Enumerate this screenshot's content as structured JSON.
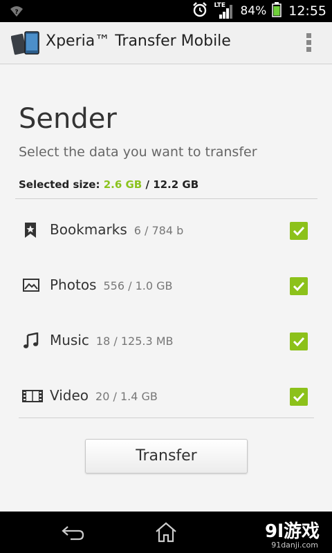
{
  "status_bar": {
    "network_label": "LTE",
    "battery_percent": "84%",
    "time": "12:55",
    "icons": [
      "wifi-icon",
      "alarm-icon",
      "signal-icon",
      "battery-icon"
    ]
  },
  "action_bar": {
    "title": "Xperia™ Transfer Mobile",
    "icons": [
      "app-logo-icon",
      "overflow-menu-icon"
    ]
  },
  "main": {
    "heading": "Sender",
    "subtitle": "Select the data you want to transfer",
    "size_label": "Selected size:",
    "selected_size": "2.6 GB",
    "size_separator": " / ",
    "total_size": "12.2 GB",
    "items": [
      {
        "label": "Bookmarks",
        "count": "6 / 784 b",
        "icon": "bookmark-icon",
        "checked": true
      },
      {
        "label": "Photos",
        "count": "556 / 1.0 GB",
        "icon": "photo-icon",
        "checked": true
      },
      {
        "label": "Music",
        "count": "18 / 125.3 MB",
        "icon": "music-note-icon",
        "checked": true
      },
      {
        "label": "Video",
        "count": "20 / 1.4 GB",
        "icon": "film-icon",
        "checked": true
      }
    ],
    "transfer_button": "Transfer"
  },
  "nav_bar": {
    "icons": [
      "back-icon",
      "home-icon"
    ],
    "watermark": "9l游戏",
    "watermark_url": "91danji.com"
  },
  "colors": {
    "accent_green": "#8cc11a",
    "selected_size_green": "#8bc31e",
    "status_bar_bg": "#000000",
    "battery_green": "#6fd03a"
  }
}
